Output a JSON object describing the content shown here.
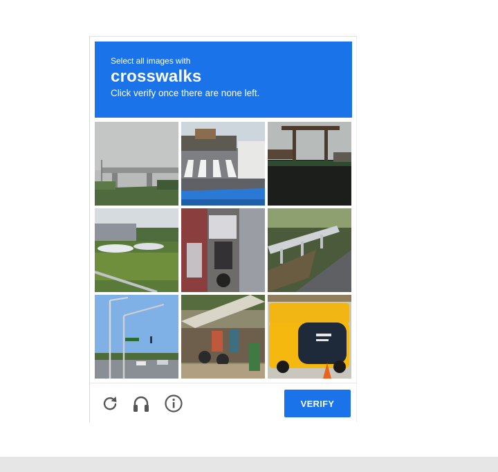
{
  "challenge": {
    "instruction": "Select all images with",
    "keyword": "crosswalks",
    "subinstruction": "Click verify once there are none left."
  },
  "tiles": [
    {
      "index": 1,
      "content": "overpass-bridge-image"
    },
    {
      "index": 2,
      "content": "crosswalk-street-image"
    },
    {
      "index": 3,
      "content": "wooden-gate-image"
    },
    {
      "index": 4,
      "content": "parked-boats-image"
    },
    {
      "index": 5,
      "content": "motorcycle-traffic-image"
    },
    {
      "index": 6,
      "content": "guardrail-road-image"
    },
    {
      "index": 7,
      "content": "street-lights-image"
    },
    {
      "index": 8,
      "content": "market-stall-image"
    },
    {
      "index": 9,
      "content": "yellow-vehicle-image"
    }
  ],
  "footer": {
    "verify_label": "VERIFY",
    "icons": [
      "reload-icon",
      "audio-headphones-icon",
      "info-icon"
    ]
  },
  "colors": {
    "accent": "#1a73e8",
    "icon": "#555555"
  }
}
